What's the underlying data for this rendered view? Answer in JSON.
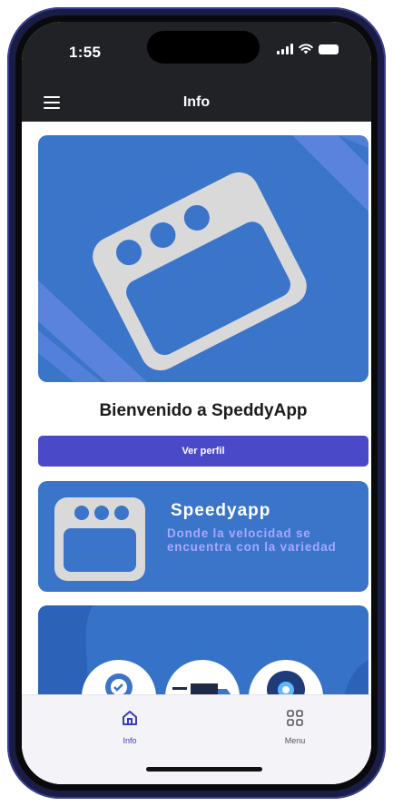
{
  "status_bar": {
    "time": "1:55",
    "icons": [
      "signal-icon",
      "wifi-icon",
      "battery-icon"
    ]
  },
  "app_bar": {
    "menu_icon": "hamburger-icon",
    "title": "Info"
  },
  "hero": {
    "image": "browser-window-icon",
    "background_color": "#3a75c9"
  },
  "welcome_text": "Bienvenido a SpeddyApp",
  "profile_button": {
    "label": "Ver perfil",
    "color": "#4a49c8"
  },
  "brand_card": {
    "name": "Speedyapp",
    "tagline": "Donde la velocidad se encuentra con la variedad",
    "icon": "browser-window-icon"
  },
  "services_card": {
    "icons": [
      "award-hand-icon",
      "delivery-truck-icon",
      "location-pin-icon"
    ]
  },
  "bottom_nav": {
    "items": [
      {
        "label": "Info",
        "icon": "home-icon",
        "active": true
      },
      {
        "label": "Menu",
        "icon": "grid-icon",
        "active": false
      }
    ],
    "active_color": "#3b3ab8"
  }
}
